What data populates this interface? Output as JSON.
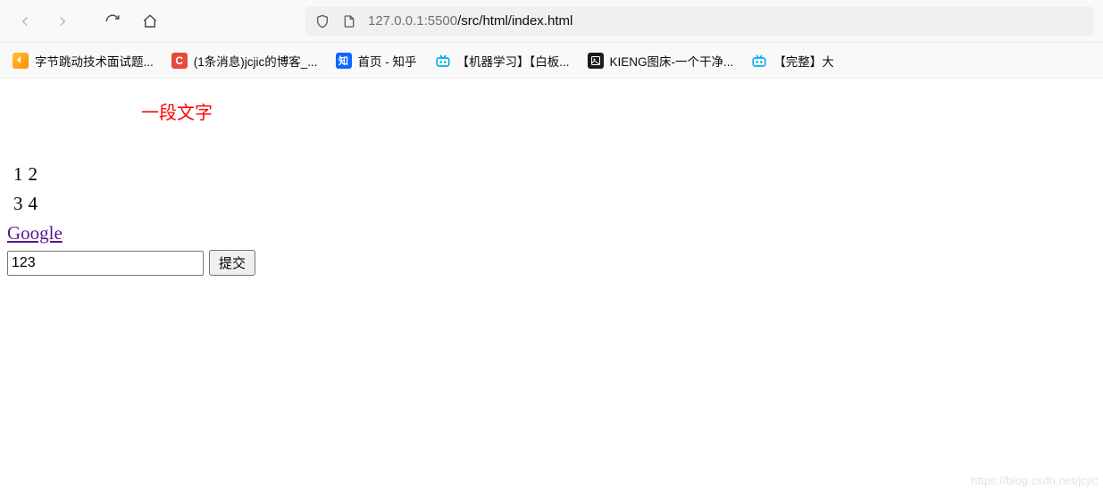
{
  "toolbar": {
    "url_host_secondary": "127.0.0.1",
    "url_port": ":5500",
    "url_path": "/src/html/index.html"
  },
  "bookmarks": [
    {
      "label": "字节跳动技术面试题...",
      "icon": "leet"
    },
    {
      "label": "(1条消息)jcjic的博客_...",
      "icon": "csdn",
      "icon_text": "C"
    },
    {
      "label": "首页 - 知乎",
      "icon": "zhihu",
      "icon_text": "知"
    },
    {
      "label": "【机器学习】【白板...",
      "icon": "bili"
    },
    {
      "label": "KIENG图床-一个干净...",
      "icon": "dark"
    },
    {
      "label": "【完整】大",
      "icon": "bili"
    }
  ],
  "page": {
    "paragraph_text": "一段文字",
    "table": {
      "rows": [
        [
          "1",
          "2"
        ],
        [
          "3",
          "4"
        ]
      ]
    },
    "link_text": "Google",
    "input_value": "123",
    "submit_label": "提交"
  },
  "watermark": "https://blog.csdn.net/jcjic"
}
